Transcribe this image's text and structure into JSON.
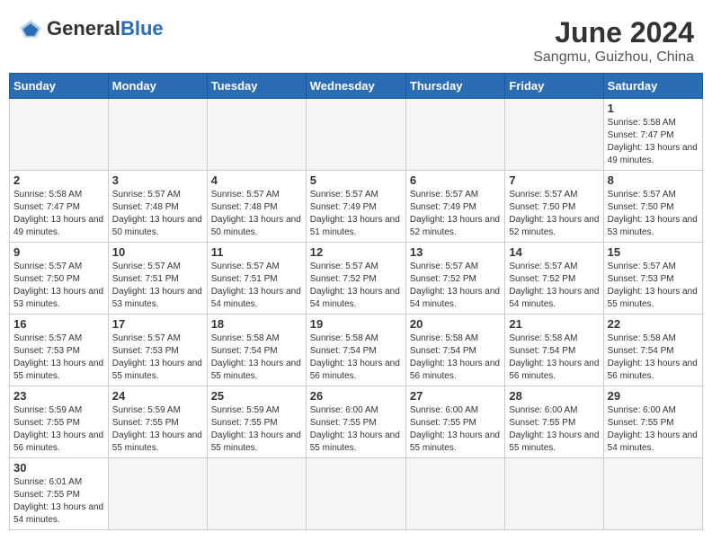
{
  "header": {
    "logo_general": "General",
    "logo_blue": "Blue",
    "title": "June 2024",
    "subtitle": "Sangmu, Guizhou, China"
  },
  "weekdays": [
    "Sunday",
    "Monday",
    "Tuesday",
    "Wednesday",
    "Thursday",
    "Friday",
    "Saturday"
  ],
  "weeks": [
    [
      {
        "day": "",
        "info": ""
      },
      {
        "day": "",
        "info": ""
      },
      {
        "day": "",
        "info": ""
      },
      {
        "day": "",
        "info": ""
      },
      {
        "day": "",
        "info": ""
      },
      {
        "day": "",
        "info": ""
      },
      {
        "day": "1",
        "info": "Sunrise: 5:58 AM\nSunset: 7:47 PM\nDaylight: 13 hours\nand 49 minutes."
      }
    ],
    [
      {
        "day": "2",
        "info": "Sunrise: 5:58 AM\nSunset: 7:47 PM\nDaylight: 13 hours\nand 49 minutes."
      },
      {
        "day": "3",
        "info": "Sunrise: 5:57 AM\nSunset: 7:48 PM\nDaylight: 13 hours\nand 50 minutes."
      },
      {
        "day": "4",
        "info": "Sunrise: 5:57 AM\nSunset: 7:48 PM\nDaylight: 13 hours\nand 50 minutes."
      },
      {
        "day": "5",
        "info": "Sunrise: 5:57 AM\nSunset: 7:49 PM\nDaylight: 13 hours\nand 51 minutes."
      },
      {
        "day": "6",
        "info": "Sunrise: 5:57 AM\nSunset: 7:49 PM\nDaylight: 13 hours\nand 52 minutes."
      },
      {
        "day": "7",
        "info": "Sunrise: 5:57 AM\nSunset: 7:50 PM\nDaylight: 13 hours\nand 52 minutes."
      },
      {
        "day": "8",
        "info": "Sunrise: 5:57 AM\nSunset: 7:50 PM\nDaylight: 13 hours\nand 53 minutes."
      }
    ],
    [
      {
        "day": "9",
        "info": "Sunrise: 5:57 AM\nSunset: 7:50 PM\nDaylight: 13 hours\nand 53 minutes."
      },
      {
        "day": "10",
        "info": "Sunrise: 5:57 AM\nSunset: 7:51 PM\nDaylight: 13 hours\nand 53 minutes."
      },
      {
        "day": "11",
        "info": "Sunrise: 5:57 AM\nSunset: 7:51 PM\nDaylight: 13 hours\nand 54 minutes."
      },
      {
        "day": "12",
        "info": "Sunrise: 5:57 AM\nSunset: 7:52 PM\nDaylight: 13 hours\nand 54 minutes."
      },
      {
        "day": "13",
        "info": "Sunrise: 5:57 AM\nSunset: 7:52 PM\nDaylight: 13 hours\nand 54 minutes."
      },
      {
        "day": "14",
        "info": "Sunrise: 5:57 AM\nSunset: 7:52 PM\nDaylight: 13 hours\nand 54 minutes."
      },
      {
        "day": "15",
        "info": "Sunrise: 5:57 AM\nSunset: 7:53 PM\nDaylight: 13 hours\nand 55 minutes."
      }
    ],
    [
      {
        "day": "16",
        "info": "Sunrise: 5:57 AM\nSunset: 7:53 PM\nDaylight: 13 hours\nand 55 minutes."
      },
      {
        "day": "17",
        "info": "Sunrise: 5:57 AM\nSunset: 7:53 PM\nDaylight: 13 hours\nand 55 minutes."
      },
      {
        "day": "18",
        "info": "Sunrise: 5:58 AM\nSunset: 7:54 PM\nDaylight: 13 hours\nand 55 minutes."
      },
      {
        "day": "19",
        "info": "Sunrise: 5:58 AM\nSunset: 7:54 PM\nDaylight: 13 hours\nand 56 minutes."
      },
      {
        "day": "20",
        "info": "Sunrise: 5:58 AM\nSunset: 7:54 PM\nDaylight: 13 hours\nand 56 minutes."
      },
      {
        "day": "21",
        "info": "Sunrise: 5:58 AM\nSunset: 7:54 PM\nDaylight: 13 hours\nand 56 minutes."
      },
      {
        "day": "22",
        "info": "Sunrise: 5:58 AM\nSunset: 7:54 PM\nDaylight: 13 hours\nand 56 minutes."
      }
    ],
    [
      {
        "day": "23",
        "info": "Sunrise: 5:59 AM\nSunset: 7:55 PM\nDaylight: 13 hours\nand 56 minutes."
      },
      {
        "day": "24",
        "info": "Sunrise: 5:59 AM\nSunset: 7:55 PM\nDaylight: 13 hours\nand 55 minutes."
      },
      {
        "day": "25",
        "info": "Sunrise: 5:59 AM\nSunset: 7:55 PM\nDaylight: 13 hours\nand 55 minutes."
      },
      {
        "day": "26",
        "info": "Sunrise: 6:00 AM\nSunset: 7:55 PM\nDaylight: 13 hours\nand 55 minutes."
      },
      {
        "day": "27",
        "info": "Sunrise: 6:00 AM\nSunset: 7:55 PM\nDaylight: 13 hours\nand 55 minutes."
      },
      {
        "day": "28",
        "info": "Sunrise: 6:00 AM\nSunset: 7:55 PM\nDaylight: 13 hours\nand 55 minutes."
      },
      {
        "day": "29",
        "info": "Sunrise: 6:00 AM\nSunset: 7:55 PM\nDaylight: 13 hours\nand 54 minutes."
      }
    ],
    [
      {
        "day": "30",
        "info": "Sunrise: 6:01 AM\nSunset: 7:55 PM\nDaylight: 13 hours\nand 54 minutes."
      },
      {
        "day": "",
        "info": ""
      },
      {
        "day": "",
        "info": ""
      },
      {
        "day": "",
        "info": ""
      },
      {
        "day": "",
        "info": ""
      },
      {
        "day": "",
        "info": ""
      },
      {
        "day": "",
        "info": ""
      }
    ]
  ]
}
